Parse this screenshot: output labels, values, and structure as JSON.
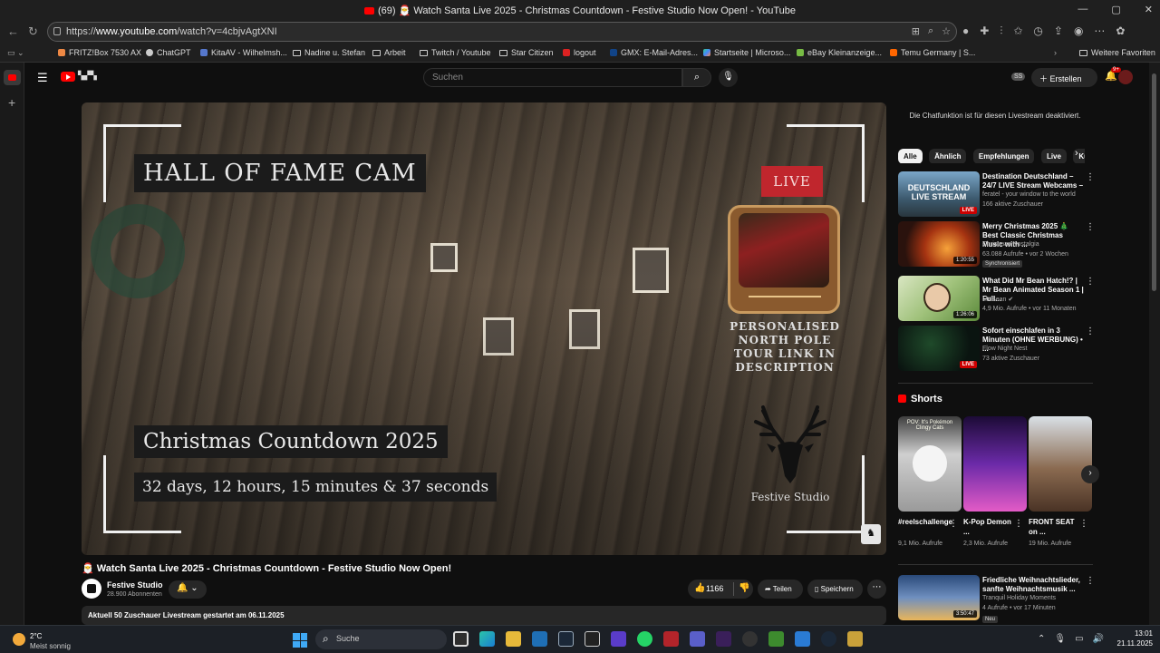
{
  "browser": {
    "tab_title": "(69) 🎅 Watch Santa Live 2025 - Christmas Countdown - Festive Studio Now Open! - YouTube",
    "url_prefix": "https://",
    "url_host": "www.youtube.com",
    "url_path": "/watch?v=4cbjvAgtXNI",
    "bookmarks": [
      "FRITZ!Box 7530 AX",
      "ChatGPT",
      "KitaAV - Wilhelmsh...",
      "Nadine u. Stefan",
      "Arbeit",
      "Twitch / Youtube",
      "Star Citizen",
      "logout",
      "GMX: E-Mail-Adres...",
      "Startseite | Microso...",
      "eBay Kleinanzeige...",
      "Temu Germany | S..."
    ],
    "other_favorites": "Weitere Favoriten"
  },
  "youtube": {
    "search_placeholder": "Suchen",
    "ss_label": "SS",
    "create_label": "Erstellen",
    "notif_count": "9+"
  },
  "player": {
    "overlay_title": "HALL OF FAME CAM",
    "live_label": "LIVE",
    "tour_text": "PERSONALISED NORTH POLE TOUR LINK IN DESCRIPTION",
    "studio_text": "Festive Studio",
    "countdown_title": "Christmas Countdown 2025",
    "countdown_value": "32 days, 12 hours, 15 minutes & 37 seconds"
  },
  "video": {
    "title": "🎅 Watch Santa Live 2025 - Christmas Countdown - Festive Studio Now Open!",
    "channel": "Festive Studio",
    "subscribers": "28.900 Abonnenten",
    "likes": "1166",
    "share_label": "Teilen",
    "save_label": "Speichern",
    "desc": "Aktuell 50 Zuschauer  Livestream gestartet am 06.11.2025"
  },
  "sidebar": {
    "chat_disabled": "Die Chatfunktion ist für diesen Livestream deaktiviert.",
    "chips": [
      "Alle",
      "Ähnlich",
      "Empfehlungen",
      "Live",
      "Kü"
    ],
    "recs": [
      {
        "title": "Destination Deutschland – 24/7 LIVE Stream Webcams –",
        "channel": "feratel - your window to the world",
        "meta": "166 aktive Zuschauer",
        "badge": "LIVE",
        "thumb_text": "DEUTSCHLAND LIVE STREAM"
      },
      {
        "title": "Merry Christmas 2025 🎄 Best Classic Christmas Music with ...",
        "channel": "Christmas Nostalgia",
        "meta": "63.088 Aufrufe • vor 2 Wochen",
        "badge": "1:20:55",
        "extra": "Synchronisiert"
      },
      {
        "title": "What Did Mr Bean Hatch!? | Mr Bean Animated Season 1 | Full...",
        "channel": "Mr Bean ✔",
        "meta": "4,9 Mio. Aufrufe • vor 11 Monaten",
        "badge": "1:26:06"
      },
      {
        "title": "Sofort einschlafen in 3 Minuten (OHNE WERBUNG) • ...",
        "channel": "Flow Night Nest",
        "meta": "73 aktive Zuschauer",
        "badge": "LIVE"
      }
    ],
    "shorts_heading": "Shorts",
    "shorts": [
      {
        "title": "#reelschallenge",
        "views": "9,1 Mio. Aufrufe",
        "thumb_text": "POV: It's Pokémon Clingy Cats"
      },
      {
        "title": "K-Pop Demon ...",
        "views": "2,3 Mio. Aufrufe"
      },
      {
        "title": "FRONT SEAT on ...",
        "views": "19 Mio. Aufrufe"
      }
    ],
    "rec5": {
      "title": "Friedliche Weihnachtslieder, sanfte Weihnachtsmusik ...",
      "channel": "Tranquil Holiday Moments",
      "meta": "4 Aufrufe • vor 17 Minuten",
      "badge": "3:50:47",
      "extra": "Neu"
    }
  },
  "taskbar": {
    "temp": "2°C",
    "weather": "Meist sonnig",
    "search": "Suche",
    "time": "13:01",
    "date": "21.11.2025"
  }
}
